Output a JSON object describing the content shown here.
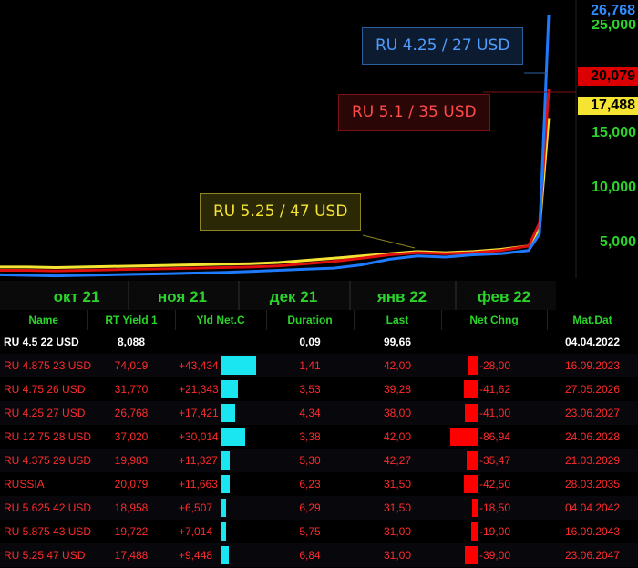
{
  "chart_data": {
    "type": "line",
    "x_labels": [
      "окт 21",
      "ноя 21",
      "дек 21",
      "янв 22",
      "фев 22"
    ],
    "y_ticks": [
      "5,000",
      "10,000",
      "15,000",
      "25,000"
    ],
    "ylim": [
      3000,
      27500
    ],
    "series": [
      {
        "name": "RU 4.25 / 27 USD",
        "color": "#1e7bff",
        "values": [
          3300,
          3250,
          3200,
          3250,
          3300,
          3350,
          3400,
          3450,
          3500,
          3600,
          3700,
          3800,
          3900,
          4200,
          4700,
          5000,
          4900,
          5100,
          5200,
          5500,
          7000,
          26768
        ],
        "last": "26,768"
      },
      {
        "name": "RU 5.1 / 35 USD",
        "color": "#e01010",
        "values": [
          3700,
          3700,
          3650,
          3700,
          3750,
          3800,
          3850,
          3900,
          3950,
          4000,
          4100,
          4300,
          4500,
          4800,
          5100,
          5300,
          5200,
          5300,
          5500,
          5900,
          8000,
          20079
        ],
        "last": "20,079"
      },
      {
        "name": "RU 5.25 / 47 USD",
        "color": "#f5e431",
        "values": [
          4000,
          4000,
          3950,
          4000,
          4050,
          4100,
          4150,
          4200,
          4250,
          4300,
          4400,
          4600,
          4800,
          5000,
          5200,
          5400,
          5300,
          5400,
          5600,
          5900,
          7500,
          17488
        ],
        "last": "17,488"
      }
    ]
  },
  "table": {
    "headers": [
      "Name",
      "RT Yield 1",
      "Yld Net.C",
      "Duration",
      "Last",
      "Net Chng",
      "Mat.Dat"
    ],
    "rows": [
      {
        "name": "RU 4.5 22 USD",
        "yield": "8,088",
        "yld_net": "",
        "yld_bar": 0,
        "duration": "0,09",
        "last": "99,66",
        "net_chng": "",
        "chng_bar": 0,
        "mat": "04.04.2022",
        "style": "first"
      },
      {
        "name": "RU 4.875 23 USD",
        "yield": "74,019",
        "yld_net": "+43,434",
        "yld_bar": 43.434,
        "duration": "1,41",
        "last": "42,00",
        "net_chng": "-28,00",
        "chng_bar": 28.0,
        "mat": "16.09.2023",
        "style": "red"
      },
      {
        "name": "RU 4.75 26 USD",
        "yield": "31,770",
        "yld_net": "+21,343",
        "yld_bar": 21.343,
        "duration": "3,53",
        "last": "39,28",
        "net_chng": "-41,62",
        "chng_bar": 41.62,
        "mat": "27.05.2026",
        "style": "red"
      },
      {
        "name": "RU 4.25 27 USD",
        "yield": "26,768",
        "yld_net": "+17,421",
        "yld_bar": 17.421,
        "duration": "4,34",
        "last": "38,00",
        "net_chng": "-41,00",
        "chng_bar": 41.0,
        "mat": "23.06.2027",
        "style": "red"
      },
      {
        "name": "RU 12.75 28 USD",
        "yield": "37,020",
        "yld_net": "+30,014",
        "yld_bar": 30.014,
        "duration": "3,38",
        "last": "42,00",
        "net_chng": "-86,94",
        "chng_bar": 86.94,
        "mat": "24.06.2028",
        "style": "red"
      },
      {
        "name": "RU 4.375 29 USD",
        "yield": "19,983",
        "yld_net": "+11,327",
        "yld_bar": 11.327,
        "duration": "5,30",
        "last": "42,27",
        "net_chng": "-35,47",
        "chng_bar": 35.47,
        "mat": "21.03.2029",
        "style": "red"
      },
      {
        "name": "RUSSIA",
        "yield": "20,079",
        "yld_net": "+11,663",
        "yld_bar": 11.663,
        "duration": "6,23",
        "last": "31,50",
        "net_chng": "-42,50",
        "chng_bar": 42.5,
        "mat": "28.03.2035",
        "style": "red"
      },
      {
        "name": "RU 5.625 42 USD",
        "yield": "18,958",
        "yld_net": "+6,507",
        "yld_bar": 6.507,
        "duration": "6,29",
        "last": "31,50",
        "net_chng": "-18,50",
        "chng_bar": 18.5,
        "mat": "04.04.2042",
        "style": "red"
      },
      {
        "name": "RU 5.875 43 USD",
        "yield": "19,722",
        "yld_net": "+7,014",
        "yld_bar": 7.014,
        "duration": "5,75",
        "last": "31,00",
        "net_chng": "-19,00",
        "chng_bar": 19.0,
        "mat": "16.09.2043",
        "style": "red"
      },
      {
        "name": "RU 5.25 47 USD",
        "yield": "17,488",
        "yld_net": "+9,448",
        "yld_bar": 9.448,
        "duration": "6,84",
        "last": "31,00",
        "net_chng": "-39,00",
        "chng_bar": 39.0,
        "mat": "23.06.2047",
        "style": "red"
      }
    ]
  }
}
